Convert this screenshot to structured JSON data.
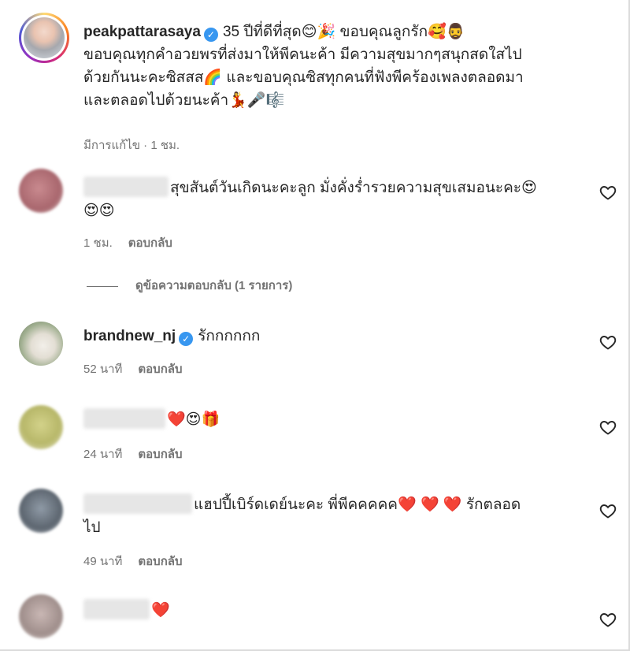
{
  "caption": {
    "username": "peakpattarasaya",
    "text_line1": "35 ปีที่ดีที่สุด😊🎉 ขอบคุณลูกรัก🥰🧔‍♂️",
    "text_line2": "ขอบคุณทุกคำอวยพรที่ส่งมาให้พีคนะค้า มีความสุขมากๆสนุกสดใสไป",
    "text_line3": "ด้วยกันนะคะซิสสส🌈 และขอบคุณซิสทุกคนที่ฟังพีคร้องเพลงตลอดมา",
    "text_line4": "และตลอดไปด้วยนะค้า💃🎤🎼",
    "meta": "มีการแก้ไข · 1 ชม."
  },
  "view_replies": "ดูข้อความตอบกลับ (1 รายการ)",
  "reply_label": "ตอบกลับ",
  "comments": [
    {
      "text_line1": "สุขสันต์วันเกิดนะคะลูก มั่งคั่งร่ำรวยความสุขเสมอนะคะ😍",
      "text_line2": "😍😍",
      "time": "1 ชม."
    },
    {
      "username": "brandnew_nj",
      "text_line1": "รักกกกกก",
      "time": "52 นาที"
    },
    {
      "text_line1": "❤️😍🎁",
      "time": "24 นาที"
    },
    {
      "text_line1": "แฮปปี้เบิร์ดเดย์นะคะ พี่พีคคคคค❤️ ❤️ ❤️ รักตลอด",
      "text_line2": "ไป",
      "time": "49 นาที"
    },
    {
      "text_line1": "❤️"
    }
  ],
  "colors": {
    "verified": "#3897f0",
    "meta": "#737373",
    "text": "#262626"
  },
  "icons": {
    "like": "heart-outline-icon",
    "verified": "verified-badge-icon"
  }
}
